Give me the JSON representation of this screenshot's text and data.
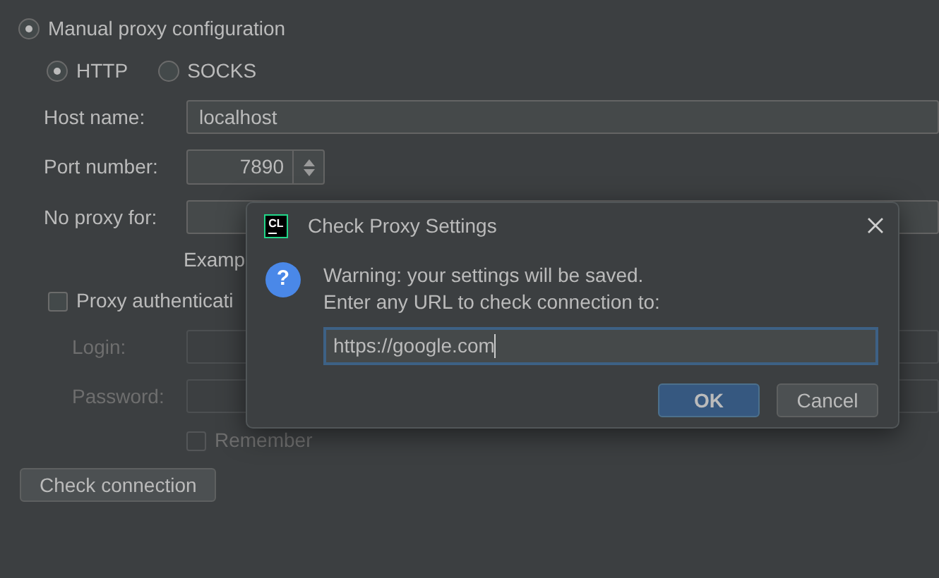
{
  "proxy_mode": {
    "label": "Manual proxy configuration",
    "selected": true
  },
  "protocols": [
    {
      "label": "HTTP",
      "selected": true
    },
    {
      "label": "SOCKS",
      "selected": false
    }
  ],
  "host": {
    "label": "Host name:",
    "value": "localhost"
  },
  "port": {
    "label": "Port number:",
    "value": "7890"
  },
  "no_proxy": {
    "label": "No proxy for:",
    "hint": "Examp"
  },
  "auth": {
    "label": "Proxy authenticati",
    "checked": false
  },
  "login": {
    "label": "Login:",
    "disabled": true
  },
  "password": {
    "label": "Password:",
    "disabled": true
  },
  "remember": {
    "label": "Remember",
    "checked": false,
    "disabled": true
  },
  "check_button": "Check connection",
  "dialog": {
    "title": "Check Proxy Settings",
    "logo": "CL",
    "icon": "?",
    "message": [
      "Warning: your settings will be saved.",
      "Enter any URL to check connection to:"
    ],
    "url": "https://google.com",
    "buttons": [
      {
        "label": "OK",
        "kind": "primary"
      },
      {
        "label": "Cancel",
        "kind": "secondary"
      }
    ]
  }
}
